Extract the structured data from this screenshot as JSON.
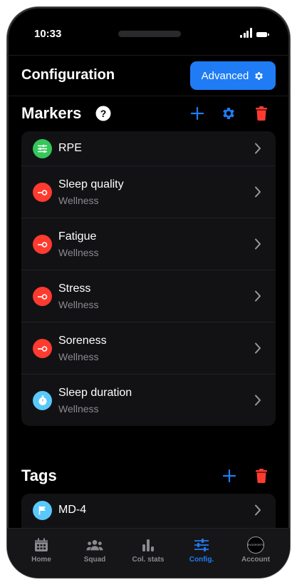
{
  "status_bar": {
    "time": "10:33"
  },
  "header": {
    "title": "Configuration",
    "advanced_label": "Advanced"
  },
  "markers": {
    "title": "Markers",
    "items": [
      {
        "label": "RPE",
        "sublabel": "",
        "icon": "sliders-icon",
        "color": "#34c759"
      },
      {
        "label": "Sleep quality",
        "sublabel": "Wellness",
        "icon": "slider-knob-icon",
        "color": "#ff3b30"
      },
      {
        "label": "Fatigue",
        "sublabel": "Wellness",
        "icon": "slider-knob-icon",
        "color": "#ff3b30"
      },
      {
        "label": "Stress",
        "sublabel": "Wellness",
        "icon": "slider-knob-icon",
        "color": "#ff3b30"
      },
      {
        "label": "Soreness",
        "sublabel": "Wellness",
        "icon": "slider-knob-icon",
        "color": "#ff3b30"
      },
      {
        "label": "Sleep duration",
        "sublabel": "Wellness",
        "icon": "stopwatch-icon",
        "color": "#5ac8fa"
      }
    ]
  },
  "tags": {
    "title": "Tags",
    "items": [
      {
        "label": "MD-4",
        "icon": "flag-icon",
        "color": "#5ac8fa"
      }
    ]
  },
  "tab_bar": {
    "tabs": [
      {
        "label": "Home",
        "icon": "calendar-icon",
        "active": false
      },
      {
        "label": "Squad",
        "icon": "group-icon",
        "active": false
      },
      {
        "label": "Col. stats",
        "icon": "bar-chart-icon",
        "active": false
      },
      {
        "label": "Config.",
        "icon": "sliders-icon",
        "active": true
      },
      {
        "label": "Account",
        "icon": "avatar-icon",
        "active": false
      }
    ],
    "avatar_text": "EVOSPORTS"
  },
  "colors": {
    "accent": "#1f7cf5",
    "danger": "#ff3b30",
    "background": "#000000",
    "card": "#121215"
  }
}
